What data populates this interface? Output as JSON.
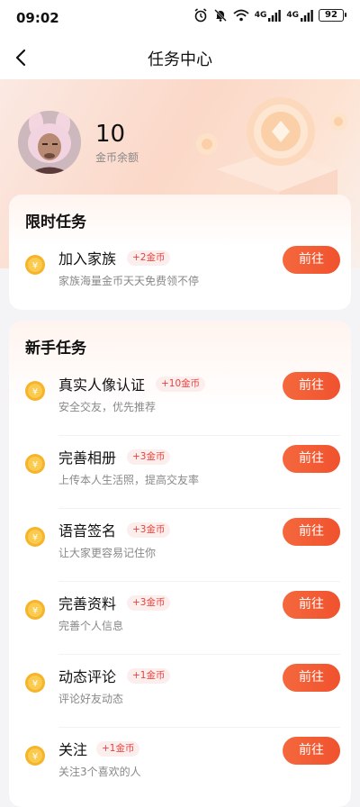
{
  "status_bar": {
    "time": "09:02",
    "battery": "92",
    "net1": "4G",
    "net2": "4G"
  },
  "nav": {
    "title": "任务中心"
  },
  "wallet": {
    "balance": "10",
    "balance_label": "金币余额"
  },
  "limited_section": {
    "title": "限时任务",
    "tasks": [
      {
        "title": "加入家族",
        "reward": "+2金币",
        "desc": "家族海量金币天天免费领不停",
        "button": "前往"
      }
    ]
  },
  "newbie_section": {
    "title": "新手任务",
    "tasks": [
      {
        "title": "真实人像认证",
        "reward": "+10金币",
        "desc": "安全交友，优先推荐",
        "button": "前往"
      },
      {
        "title": "完善相册",
        "reward": "+3金币",
        "desc": "上传本人生活照，提高交友率",
        "button": "前往"
      },
      {
        "title": "语音签名",
        "reward": "+3金币",
        "desc": "让大家更容易记住你",
        "button": "前往"
      },
      {
        "title": "完善资料",
        "reward": "+3金币",
        "desc": "完善个人信息",
        "button": "前往"
      },
      {
        "title": "动态评论",
        "reward": "+1金币",
        "desc": "评论好友动态",
        "button": "前往"
      },
      {
        "title": "关注",
        "reward": "+1金币",
        "desc": "关注3个喜欢的人",
        "button": "前往"
      }
    ]
  },
  "colors": {
    "accent": "#f0522e",
    "reward_text": "#e8423c",
    "reward_bg": "#fdeeee",
    "coin": "#f6b42a"
  }
}
